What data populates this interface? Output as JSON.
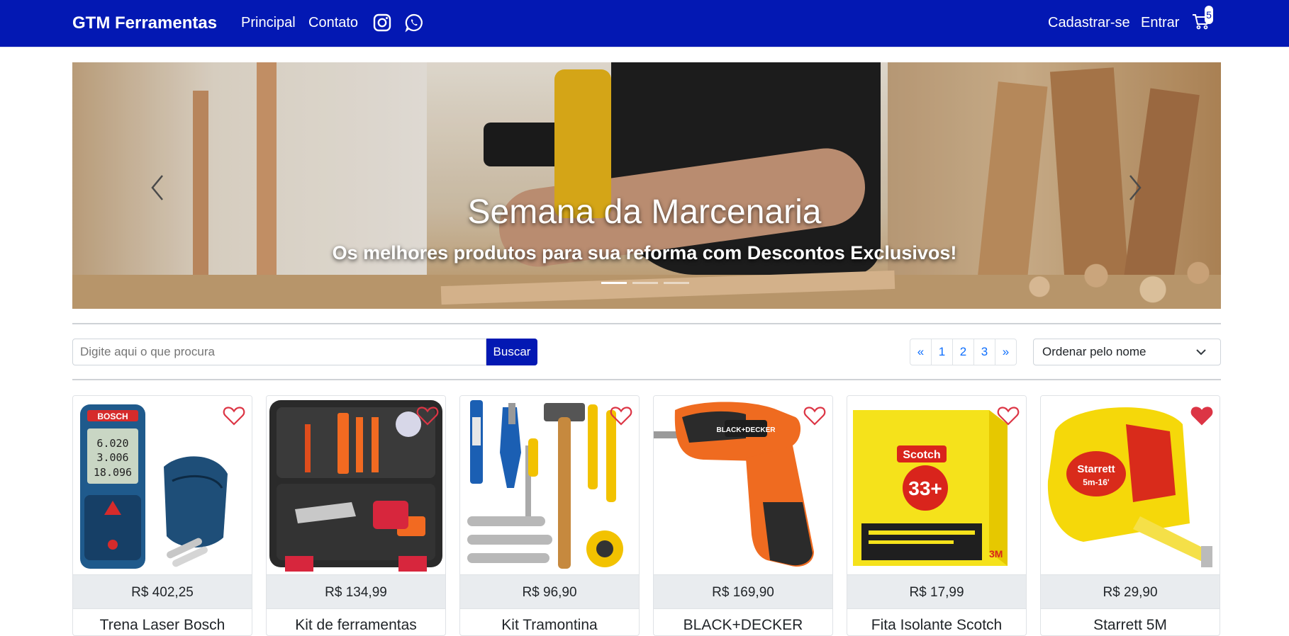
{
  "nav": {
    "brand": "GTM Ferramentas",
    "links": [
      "Principal",
      "Contato"
    ],
    "social_icons": [
      "instagram-icon",
      "whatsapp-icon"
    ],
    "right_links": [
      "Cadastrar-se",
      "Entrar"
    ],
    "cart_icon": "cart-icon",
    "cart_count": "5",
    "background_color": "#0318b3"
  },
  "banner": {
    "title": "Semana da Marcenaria",
    "subtitle": "Os melhores produtos para sua reforma com Descontos Exclusivos!",
    "slide_count": 3,
    "active_slide": 1
  },
  "search": {
    "placeholder": "Digite aqui o que procura",
    "button_label": "Buscar"
  },
  "pagination": {
    "items": [
      "«",
      "1",
      "2",
      "3",
      "»"
    ]
  },
  "sort": {
    "selected": "Ordenar pelo nome"
  },
  "products": [
    {
      "price": "R$ 402,25",
      "name": "Trena Laser Bosch",
      "favorite": false,
      "image": "laser-measure-image"
    },
    {
      "price": "R$ 134,99",
      "name": "Kit de ferramentas",
      "favorite": false,
      "image": "tool-kit-case-image"
    },
    {
      "price": "R$ 96,90",
      "name": "Kit Tramontina",
      "favorite": false,
      "image": "hand-tools-set-image"
    },
    {
      "price": "R$ 169,90",
      "name": "BLACK+DECKER",
      "favorite": false,
      "image": "screwdriver-image"
    },
    {
      "price": "R$ 17,99",
      "name": "Fita Isolante Scotch",
      "favorite": false,
      "image": "insulating-tape-image"
    },
    {
      "price": "R$ 29,90",
      "name": "Starrett 5M",
      "favorite": true,
      "image": "tape-measure-image"
    }
  ],
  "colors": {
    "heart": "#dc3545",
    "link": "#0d6efd",
    "price_bg": "#e9ecef"
  }
}
